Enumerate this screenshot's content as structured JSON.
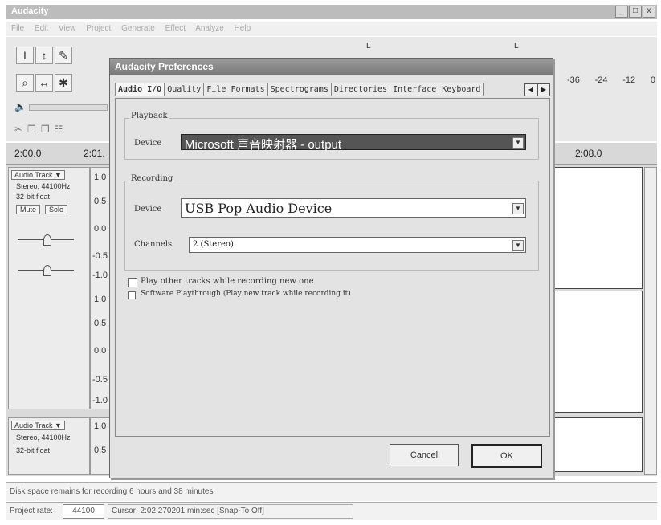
{
  "app": {
    "title": "Audacity",
    "window_buttons": [
      "_",
      "□",
      "x"
    ],
    "menu": [
      "File",
      "Edit",
      "View",
      "Project",
      "Generate",
      "Effect",
      "Analyze",
      "Help"
    ]
  },
  "toolbar": {
    "tools": [
      "I",
      "↕",
      "✎",
      "⌕",
      "↔",
      "✱"
    ],
    "meter_labels": [
      "-36",
      "-24",
      "-12",
      "0"
    ],
    "cursor_marks": [
      "L",
      "L"
    ]
  },
  "ruler": {
    "left_time": "2:00.0",
    "mid_time": "2:01.",
    "right_time": "2:08.0"
  },
  "tracks": [
    {
      "name": "Audio Track",
      "format": "Stereo, 44100Hz",
      "bits": "32-bit float",
      "mute": "Mute",
      "solo": "Solo",
      "scale": [
        "1.0",
        "0.5",
        "0.0",
        "-0.5",
        "-1.0",
        "1.0",
        "0.5",
        "0.0",
        "-0.5",
        "-1.0"
      ]
    },
    {
      "name": "Audio Track",
      "format": "Stereo, 44100Hz",
      "bits": "32-bit float",
      "scale": [
        "1.0",
        "0.5"
      ]
    }
  ],
  "status": {
    "disk_space": "Disk space remains for recording 6 hours and 38 minutes",
    "project_rate_label": "Project rate:",
    "project_rate": "44100",
    "cursor": "Cursor: 2:02.270201 min:sec   [Snap-To Off]"
  },
  "dialog": {
    "title": "Audacity Preferences",
    "tabs": [
      "Audio I/O",
      "Quality",
      "File Formats",
      "Spectrograms",
      "Directories",
      "Interface",
      "Keyboard"
    ],
    "playback": {
      "group_label": "Playback",
      "device_label": "Device",
      "device_value": "Microsoft 声音映射器 - output"
    },
    "recording": {
      "group_label": "Recording",
      "device_label": "Device",
      "device_value": "USB Pop Audio Device",
      "channels_label": "Channels",
      "channels_value": "2 (Stereo)"
    },
    "options": [
      {
        "label": "Play other tracks while recording new one",
        "checked": false
      },
      {
        "label": "Software Playthrough (Play new track while recording it)",
        "checked": false
      }
    ],
    "cancel_label": "Cancel",
    "ok_label": "OK"
  }
}
